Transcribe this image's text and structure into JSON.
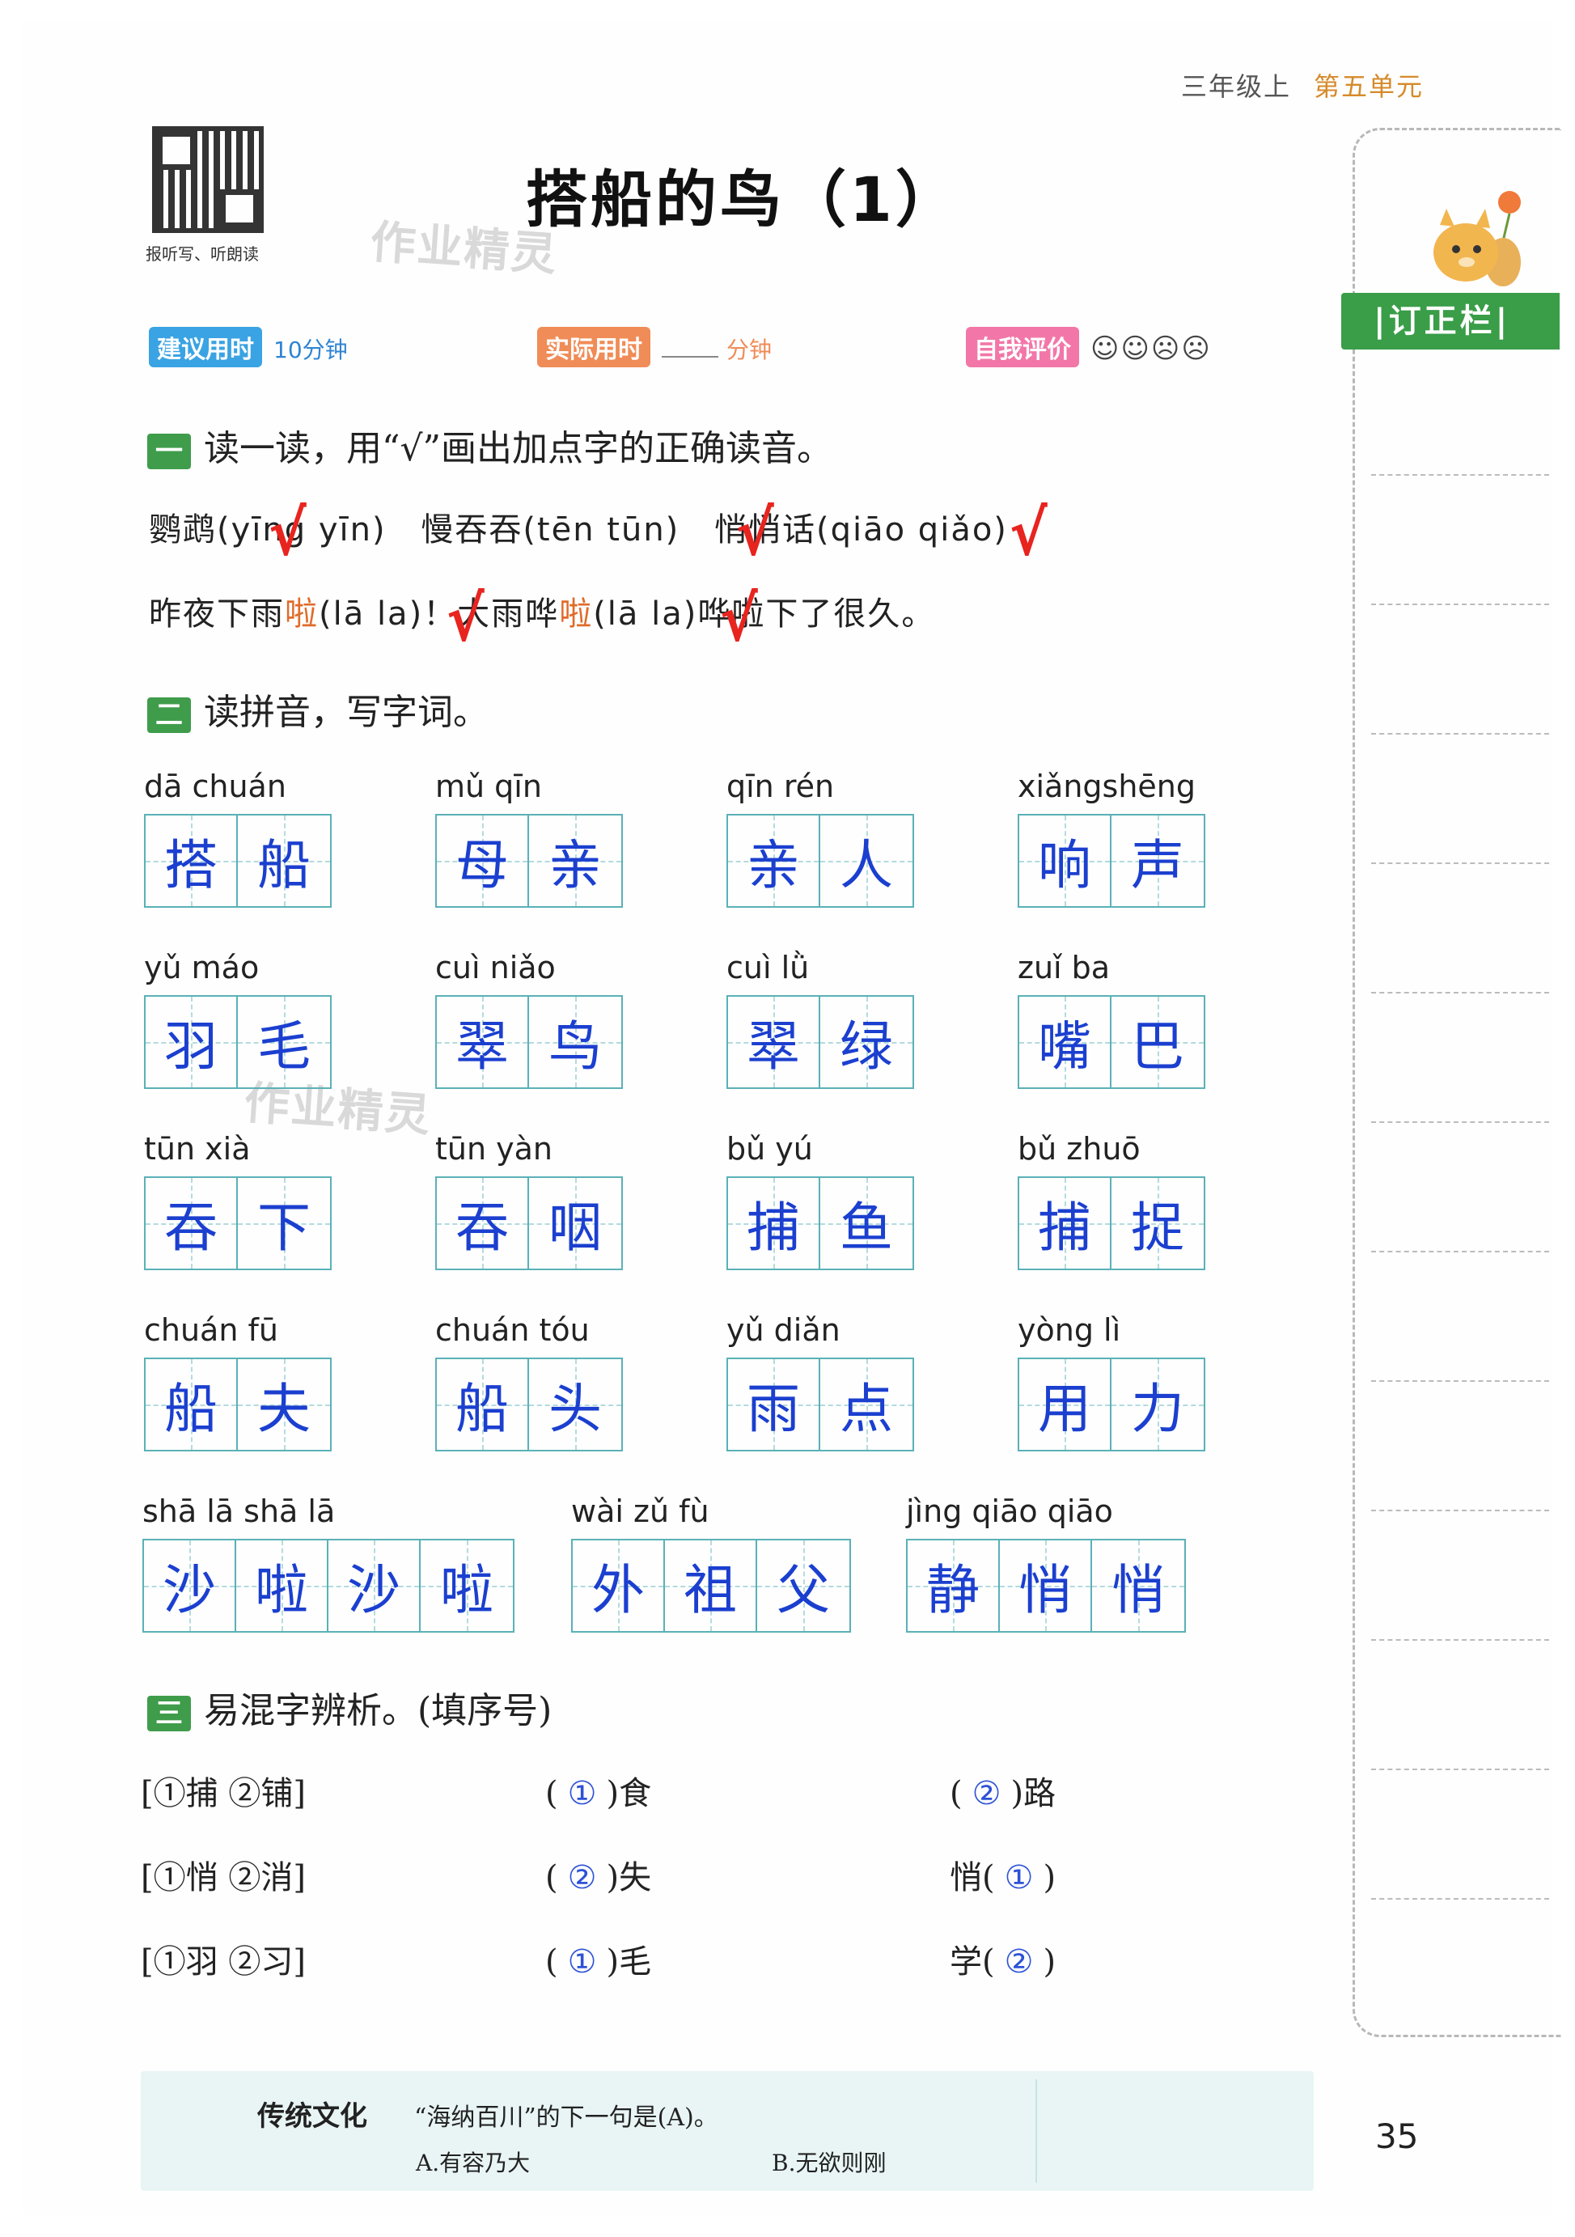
{
  "header": {
    "grade": "三年级上",
    "unit": "第五单元"
  },
  "qr_caption": "报听写、听朗读",
  "title": "搭船的鸟（1）",
  "watermark": "作业精灵",
  "time_row": {
    "suggested_label": "建议用时",
    "suggested_value": "10分钟",
    "actual_label": "实际用时",
    "actual_unit": "分钟",
    "self_label": "自我评价",
    "faces": "☺☺☹☹"
  },
  "section1": {
    "num": "一",
    "heading": "读一读，用“√”画出加点字的正确读音。",
    "line1": [
      {
        "word": "鹦鹉",
        "opts": "(yīng   yīn)"
      },
      {
        "word": "慢吞吞",
        "opts": "(tēn   tūn)"
      },
      {
        "word": "悄悄话",
        "opts": "(qiāo   qiǎo)"
      }
    ],
    "line2_a": "昨夜下雨",
    "line2_hl1": "啦",
    "line2_b": "(lā   la)！大雨哗",
    "line2_hl2": "啦",
    "line2_c": "(lā   la)哗啦下了很久。",
    "check_mark": "√"
  },
  "section2": {
    "num": "二",
    "heading": "读拼音，写字词。",
    "words": [
      {
        "pinyin": "dā chuán",
        "chars": [
          "搭",
          "船"
        ]
      },
      {
        "pinyin": "mǔ   qīn",
        "chars": [
          "母",
          "亲"
        ]
      },
      {
        "pinyin": "qīn   rén",
        "chars": [
          "亲",
          "人"
        ]
      },
      {
        "pinyin": "xiǎngshēng",
        "chars": [
          "响",
          "声"
        ]
      },
      {
        "pinyin": "yǔ  máo",
        "chars": [
          "羽",
          "毛"
        ]
      },
      {
        "pinyin": "cuì  niǎo",
        "chars": [
          "翠",
          "鸟"
        ]
      },
      {
        "pinyin": "cuì    lǜ",
        "chars": [
          "翠",
          "绿"
        ]
      },
      {
        "pinyin": "zuǐ    ba",
        "chars": [
          "嘴",
          "巴"
        ]
      },
      {
        "pinyin": "tūn   xià",
        "chars": [
          "吞",
          "下"
        ]
      },
      {
        "pinyin": "tūn   yàn",
        "chars": [
          "吞",
          "咽"
        ]
      },
      {
        "pinyin": "bǔ    yú",
        "chars": [
          "捕",
          "鱼"
        ]
      },
      {
        "pinyin": "bǔ  zhuō",
        "chars": [
          "捕",
          "捉"
        ]
      },
      {
        "pinyin": "chuán  fū",
        "chars": [
          "船",
          "夫"
        ]
      },
      {
        "pinyin": "chuán tóu",
        "chars": [
          "船",
          "头"
        ]
      },
      {
        "pinyin": "yǔ   diǎn",
        "chars": [
          "雨",
          "点"
        ]
      },
      {
        "pinyin": "yòng    lì",
        "chars": [
          "用",
          "力"
        ]
      },
      {
        "pinyin": "shā    lā   shā    lā",
        "chars": [
          "沙",
          "啦",
          "沙",
          "啦"
        ]
      },
      {
        "pinyin": "wài    zǔ     fù",
        "chars": [
          "外",
          "祖",
          "父"
        ]
      },
      {
        "pinyin": "jìng qiāo qiāo",
        "chars": [
          "静",
          "悄",
          "悄"
        ]
      }
    ]
  },
  "section3": {
    "num": "三",
    "heading": "易混字辨析。(填序号)",
    "rows": [
      {
        "opt": "[①捕  ②铺]",
        "c1_pre": "(",
        "c1_ans": "①",
        "c1_post": ")食",
        "c2_pre": "(",
        "c2_ans": "②",
        "c2_post": ")路"
      },
      {
        "opt": "[①悄  ②消]",
        "c1_pre": "(",
        "c1_ans": "②",
        "c1_post": ")失",
        "c2_pre": "悄(",
        "c2_ans": "①",
        "c2_post": ")"
      },
      {
        "opt": "[①羽  ②习]",
        "c1_pre": "(",
        "c1_ans": "①",
        "c1_post": ")毛",
        "c2_pre": "学(",
        "c2_ans": "②",
        "c2_post": ")"
      }
    ]
  },
  "sidebar": {
    "tab_label": "|订正栏|"
  },
  "bottom": {
    "title": "传统文化",
    "question": "“海纳百川”的下一句是(A)。",
    "option_a": "A.有容乃大",
    "option_b": "B.无欲则刚"
  },
  "page_number": "35"
}
